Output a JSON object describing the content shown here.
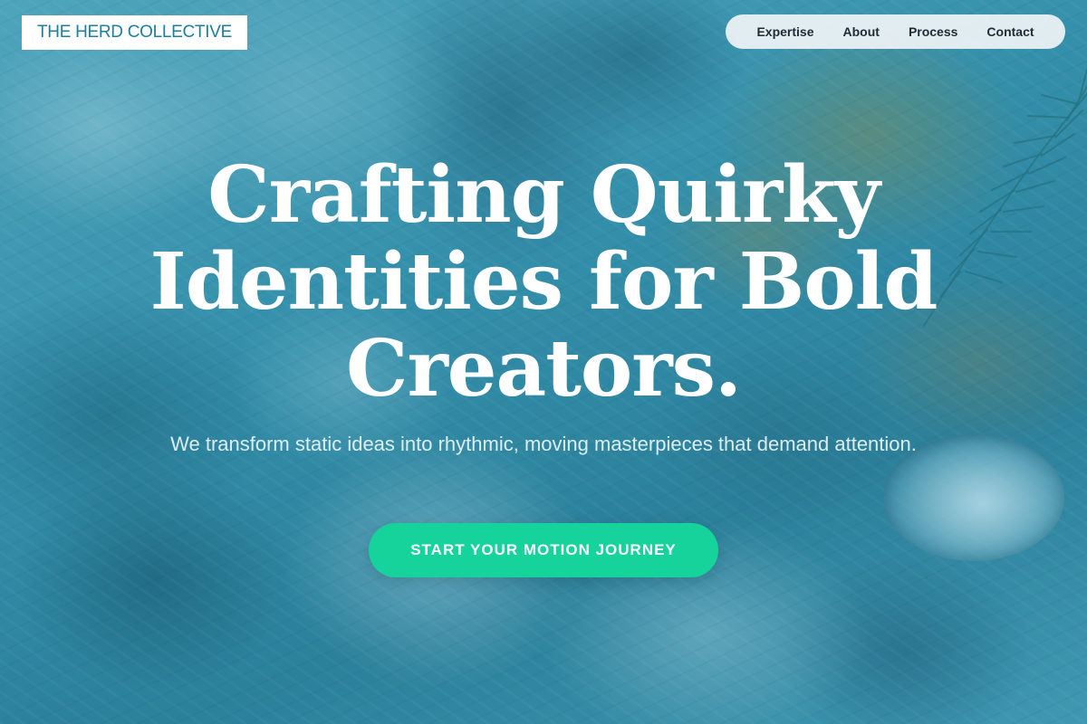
{
  "header": {
    "logo_text": "THE HERD COLLECTIVE",
    "nav": [
      {
        "label": "Expertise"
      },
      {
        "label": "About"
      },
      {
        "label": "Process"
      },
      {
        "label": "Contact"
      }
    ]
  },
  "hero": {
    "headline": "Crafting Quirky Identities for Bold Creators.",
    "subtitle": "We transform static ideas into rhythmic, moving masterpieces that demand attention.",
    "cta_label": "START YOUR MOTION JOURNEY"
  },
  "colors": {
    "accent": "#16d39c",
    "brand_text": "#1b7f9d",
    "background_tint": "#3a93ad"
  },
  "icons": {
    "background": "painted-texture-image"
  }
}
